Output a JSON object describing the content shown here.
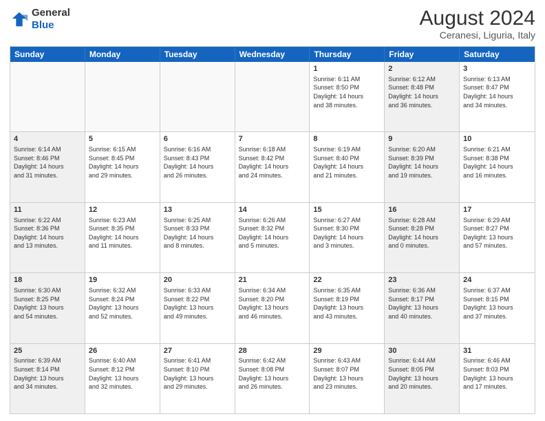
{
  "header": {
    "logo": {
      "line1": "General",
      "line2": "Blue"
    },
    "title": "August 2024",
    "location": "Ceranesi, Liguria, Italy"
  },
  "weekdays": [
    "Sunday",
    "Monday",
    "Tuesday",
    "Wednesday",
    "Thursday",
    "Friday",
    "Saturday"
  ],
  "weeks": [
    [
      {
        "day": "",
        "info": "",
        "shaded": false
      },
      {
        "day": "",
        "info": "",
        "shaded": false
      },
      {
        "day": "",
        "info": "",
        "shaded": false
      },
      {
        "day": "",
        "info": "",
        "shaded": false
      },
      {
        "day": "1",
        "info": "Sunrise: 6:11 AM\nSunset: 8:50 PM\nDaylight: 14 hours\nand 38 minutes.",
        "shaded": false
      },
      {
        "day": "2",
        "info": "Sunrise: 6:12 AM\nSunset: 8:48 PM\nDaylight: 14 hours\nand 36 minutes.",
        "shaded": true
      },
      {
        "day": "3",
        "info": "Sunrise: 6:13 AM\nSunset: 8:47 PM\nDaylight: 14 hours\nand 34 minutes.",
        "shaded": false
      }
    ],
    [
      {
        "day": "4",
        "info": "Sunrise: 6:14 AM\nSunset: 8:46 PM\nDaylight: 14 hours\nand 31 minutes.",
        "shaded": true
      },
      {
        "day": "5",
        "info": "Sunrise: 6:15 AM\nSunset: 8:45 PM\nDaylight: 14 hours\nand 29 minutes.",
        "shaded": false
      },
      {
        "day": "6",
        "info": "Sunrise: 6:16 AM\nSunset: 8:43 PM\nDaylight: 14 hours\nand 26 minutes.",
        "shaded": false
      },
      {
        "day": "7",
        "info": "Sunrise: 6:18 AM\nSunset: 8:42 PM\nDaylight: 14 hours\nand 24 minutes.",
        "shaded": false
      },
      {
        "day": "8",
        "info": "Sunrise: 6:19 AM\nSunset: 8:40 PM\nDaylight: 14 hours\nand 21 minutes.",
        "shaded": false
      },
      {
        "day": "9",
        "info": "Sunrise: 6:20 AM\nSunset: 8:39 PM\nDaylight: 14 hours\nand 19 minutes.",
        "shaded": true
      },
      {
        "day": "10",
        "info": "Sunrise: 6:21 AM\nSunset: 8:38 PM\nDaylight: 14 hours\nand 16 minutes.",
        "shaded": false
      }
    ],
    [
      {
        "day": "11",
        "info": "Sunrise: 6:22 AM\nSunset: 8:36 PM\nDaylight: 14 hours\nand 13 minutes.",
        "shaded": true
      },
      {
        "day": "12",
        "info": "Sunrise: 6:23 AM\nSunset: 8:35 PM\nDaylight: 14 hours\nand 11 minutes.",
        "shaded": false
      },
      {
        "day": "13",
        "info": "Sunrise: 6:25 AM\nSunset: 8:33 PM\nDaylight: 14 hours\nand 8 minutes.",
        "shaded": false
      },
      {
        "day": "14",
        "info": "Sunrise: 6:26 AM\nSunset: 8:32 PM\nDaylight: 14 hours\nand 5 minutes.",
        "shaded": false
      },
      {
        "day": "15",
        "info": "Sunrise: 6:27 AM\nSunset: 8:30 PM\nDaylight: 14 hours\nand 3 minutes.",
        "shaded": false
      },
      {
        "day": "16",
        "info": "Sunrise: 6:28 AM\nSunset: 8:28 PM\nDaylight: 14 hours\nand 0 minutes.",
        "shaded": true
      },
      {
        "day": "17",
        "info": "Sunrise: 6:29 AM\nSunset: 8:27 PM\nDaylight: 13 hours\nand 57 minutes.",
        "shaded": false
      }
    ],
    [
      {
        "day": "18",
        "info": "Sunrise: 6:30 AM\nSunset: 8:25 PM\nDaylight: 13 hours\nand 54 minutes.",
        "shaded": true
      },
      {
        "day": "19",
        "info": "Sunrise: 6:32 AM\nSunset: 8:24 PM\nDaylight: 13 hours\nand 52 minutes.",
        "shaded": false
      },
      {
        "day": "20",
        "info": "Sunrise: 6:33 AM\nSunset: 8:22 PM\nDaylight: 13 hours\nand 49 minutes.",
        "shaded": false
      },
      {
        "day": "21",
        "info": "Sunrise: 6:34 AM\nSunset: 8:20 PM\nDaylight: 13 hours\nand 46 minutes.",
        "shaded": false
      },
      {
        "day": "22",
        "info": "Sunrise: 6:35 AM\nSunset: 8:19 PM\nDaylight: 13 hours\nand 43 minutes.",
        "shaded": false
      },
      {
        "day": "23",
        "info": "Sunrise: 6:36 AM\nSunset: 8:17 PM\nDaylight: 13 hours\nand 40 minutes.",
        "shaded": true
      },
      {
        "day": "24",
        "info": "Sunrise: 6:37 AM\nSunset: 8:15 PM\nDaylight: 13 hours\nand 37 minutes.",
        "shaded": false
      }
    ],
    [
      {
        "day": "25",
        "info": "Sunrise: 6:39 AM\nSunset: 8:14 PM\nDaylight: 13 hours\nand 34 minutes.",
        "shaded": true
      },
      {
        "day": "26",
        "info": "Sunrise: 6:40 AM\nSunset: 8:12 PM\nDaylight: 13 hours\nand 32 minutes.",
        "shaded": false
      },
      {
        "day": "27",
        "info": "Sunrise: 6:41 AM\nSunset: 8:10 PM\nDaylight: 13 hours\nand 29 minutes.",
        "shaded": false
      },
      {
        "day": "28",
        "info": "Sunrise: 6:42 AM\nSunset: 8:08 PM\nDaylight: 13 hours\nand 26 minutes.",
        "shaded": false
      },
      {
        "day": "29",
        "info": "Sunrise: 6:43 AM\nSunset: 8:07 PM\nDaylight: 13 hours\nand 23 minutes.",
        "shaded": false
      },
      {
        "day": "30",
        "info": "Sunrise: 6:44 AM\nSunset: 8:05 PM\nDaylight: 13 hours\nand 20 minutes.",
        "shaded": true
      },
      {
        "day": "31",
        "info": "Sunrise: 6:46 AM\nSunset: 8:03 PM\nDaylight: 13 hours\nand 17 minutes.",
        "shaded": false
      }
    ]
  ]
}
